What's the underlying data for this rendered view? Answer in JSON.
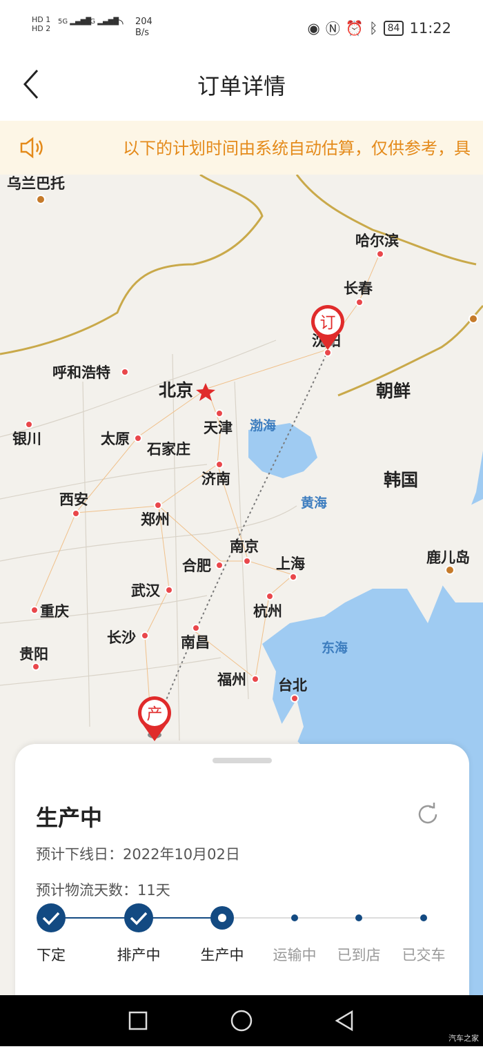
{
  "status_bar": {
    "hd1": "HD 1",
    "hd2": "HD 2",
    "sig1": "5G",
    "sig2": "4G",
    "speed_value": "204",
    "speed_unit": "B/s",
    "battery": "84",
    "time": "11:22"
  },
  "header": {
    "title": "订单详情"
  },
  "notice": {
    "text": "以下的计划时间由系统自动估算，仅供参考，具"
  },
  "map": {
    "labels": {
      "ulaanbaatar": "乌兰巴托",
      "harbin": "哈尔滨",
      "changchun": "长春",
      "shenyang": "沈阳",
      "hohhot": "呼和浩特",
      "beijing": "北京",
      "tianjin": "天津",
      "bohai": "渤海",
      "korea_north": "朝鲜",
      "yinchuan": "银川",
      "taiyuan": "太原",
      "shijiazhuang": "石家庄",
      "jinan": "济南",
      "korea_south": "韩国",
      "xian": "西安",
      "zhengzhou": "郑州",
      "yellow_sea": "黄海",
      "nanjing": "南京",
      "hefei": "合肥",
      "shanghai": "上海",
      "kagoshima": "鹿儿岛",
      "wuhan": "武汉",
      "chongqing": "重庆",
      "hangzhou": "杭州",
      "changsha": "长沙",
      "nanchang": "南昌",
      "east_sea": "东海",
      "guiyang": "贵阳",
      "fuzhou": "福州",
      "taipei": "台北"
    },
    "markers": {
      "order": "订",
      "production": "产"
    }
  },
  "sheet": {
    "status_title": "生产中",
    "expected_offline_label": "预计下线日：",
    "expected_offline_date": "2022年10月02日",
    "logistics_days_label": "预计物流天数：",
    "logistics_days": "11天",
    "steps": [
      {
        "label": "下定",
        "state": "done"
      },
      {
        "label": "排产中",
        "state": "done"
      },
      {
        "label": "生产中",
        "state": "current"
      },
      {
        "label": "运输中",
        "state": "todo"
      },
      {
        "label": "已到店",
        "state": "todo"
      },
      {
        "label": "已交车",
        "state": "todo"
      }
    ]
  },
  "watermark": "汽车之家",
  "colors": {
    "accent": "#134a82",
    "notice_text": "#e48a1a",
    "marker_red": "#e02b2b",
    "sea": "#9fcbf2",
    "land": "#f3f1ec"
  }
}
